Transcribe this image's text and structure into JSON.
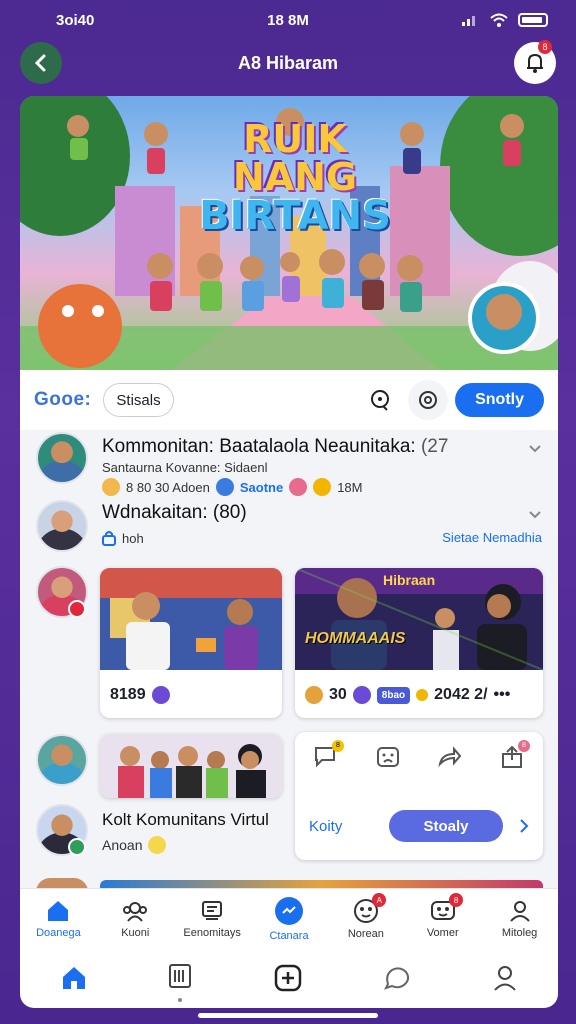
{
  "status_bar": {
    "carrier": "3oi40",
    "time": "18 8M"
  },
  "header": {
    "title": "A8 Hibaram",
    "notification_count": "8"
  },
  "hero": {
    "logo_line1": "RUIK NANG",
    "logo_line2": "BIRTANS"
  },
  "toolbar": {
    "brand": "Gooe:",
    "chip_label": "Stisals",
    "primary_label": "Snotly"
  },
  "community": {
    "title": "Kommonitan: Baatalaola Neaunitaka:",
    "count": "(27",
    "subtitle": "Santaurna Kovanne: Sidaenl",
    "meta": "8 80 30 Adoen",
    "link": "Saotne",
    "meta_end": "18M"
  },
  "invite": {
    "title": "Wdnakaitan: (80)",
    "sub": "hoh",
    "action": "Sietae Nemadhia"
  },
  "cards": {
    "left_stats": "8189",
    "right_stats_a": "30",
    "right_stats_badge": "8bao",
    "right_stats_b": "2042 2/",
    "right_overlay": "Hibraan",
    "right_sign": "HOMMAAAIS"
  },
  "virtual": {
    "title": "Kolt Komunitans Virtul",
    "sub": "Anoan"
  },
  "action_card": {
    "secondary": "Koity",
    "primary": "Stoaly",
    "badge1": "8",
    "badge2": "8"
  },
  "tabs": [
    {
      "label": "Doanega"
    },
    {
      "label": "Kuoni"
    },
    {
      "label": "Eenomitays"
    },
    {
      "label": "Ctanara"
    },
    {
      "label": "Norean",
      "badge": "A"
    },
    {
      "label": "Vomer",
      "badge": "8"
    },
    {
      "label": "Mitoleg"
    }
  ],
  "colors": {
    "accent": "#1a6ff0",
    "bg": "#4b2a91",
    "badge": "#e0283a"
  }
}
